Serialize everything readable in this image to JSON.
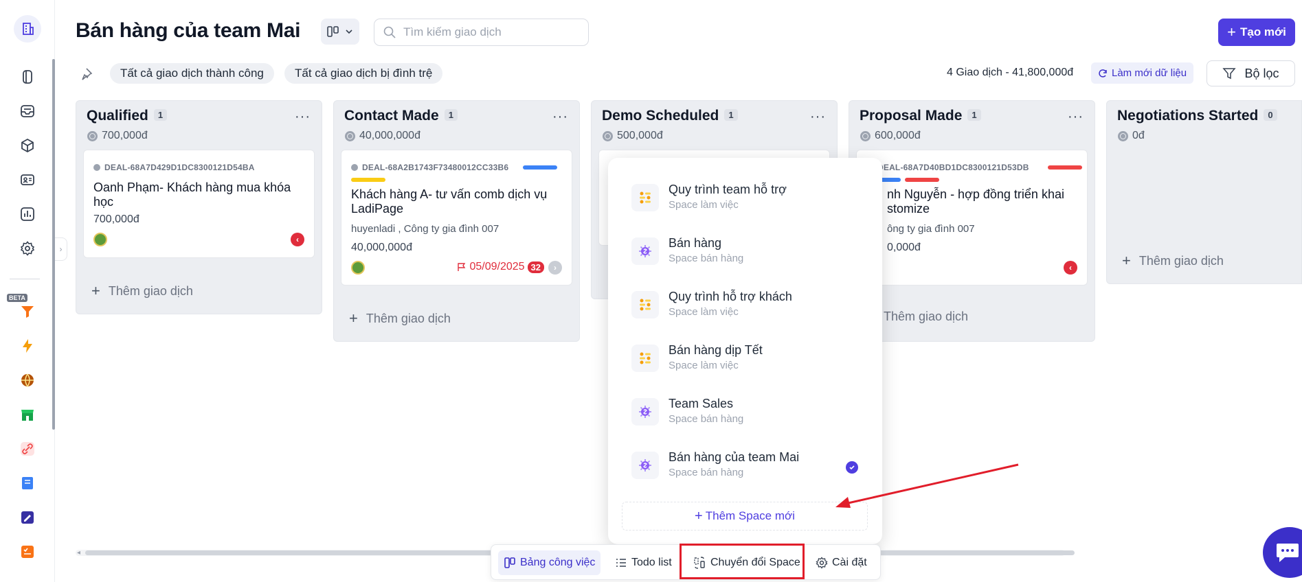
{
  "header": {
    "title": "Bán hàng của team Mai",
    "search_placeholder": "Tìm kiếm giao dịch",
    "create_label": "Tạo mới"
  },
  "filters": {
    "chip_success": "Tất cả giao dịch thành công",
    "chip_stalled": "Tất cả giao dịch bị đình trệ",
    "summary": "4 Giao dịch - 41,800,000đ",
    "refresh_label": "Làm mới dữ liệu",
    "filter_label": "Bộ lọc"
  },
  "sidebar": {
    "beta_label": "BETA",
    "icons": [
      "building-icon",
      "tablet-icon",
      "inbox-icon",
      "box-icon",
      "contact-card-icon",
      "chart-icon",
      "settings-icon",
      "funnel-icon",
      "lightning-icon",
      "globe-icon",
      "store-icon",
      "link-icon",
      "book-icon",
      "edit-note-icon",
      "checklist-icon"
    ]
  },
  "columns": [
    {
      "title": "Qualified",
      "count": "1",
      "amount": "700,000đ"
    },
    {
      "title": "Contact Made",
      "count": "1",
      "amount": "40,000,000đ"
    },
    {
      "title": "Demo Scheduled",
      "count": "1",
      "amount": "500,000đ"
    },
    {
      "title": "Proposal Made",
      "count": "1",
      "amount": "600,000đ"
    },
    {
      "title": "Negotiations Started",
      "count": "0",
      "amount": "0đ"
    }
  ],
  "cards": {
    "qualified": {
      "id": "DEAL-68A7D429D1DC8300121D54BA",
      "title": "Oanh Phạm- Khách hàng mua khóa học",
      "value": "700,000đ"
    },
    "contact": {
      "id": "DEAL-68A2B1743F73480012CC33B6",
      "title": "Khách hàng A- tư vấn comb dịch vụ LadiPage",
      "sub": "huyenladi , Công ty gia đình 007",
      "value": "40,000,000đ",
      "due": "05/09/2025",
      "due_count": "32"
    },
    "proposal": {
      "id": "DEAL-68A7D40BD1DC8300121D53DB",
      "title": "nh Nguyễn - hợp đồng triển khai stomize",
      "sub": "ông ty gia đình 007",
      "value": "0,000đ"
    }
  },
  "add_deal_label": "Thêm giao dịch",
  "popup": {
    "spaces": [
      {
        "name": "Quy trình team hỗ trợ",
        "type": "Space làm việc",
        "icon": "workflow-icon"
      },
      {
        "name": "Bán hàng",
        "type": "Space bán hàng",
        "icon": "sales-icon"
      },
      {
        "name": "Quy trình hỗ trợ khách",
        "type": "Space làm việc",
        "icon": "workflow-icon"
      },
      {
        "name": "Bán hàng dịp Tết",
        "type": "Space làm việc",
        "icon": "workflow-icon"
      },
      {
        "name": "Team Sales",
        "type": "Space bán hàng",
        "icon": "sales-icon"
      },
      {
        "name": "Bán hàng của team Mai",
        "type": "Space bán hàng",
        "icon": "sales-icon",
        "selected": true
      }
    ],
    "add_space_label": "Thêm Space mới"
  },
  "toolbar": {
    "board_label": "Bảng công việc",
    "todo_label": "Todo list",
    "switch_label": "Chuyển đổi Space",
    "settings_label": "Cài đặt"
  },
  "colors": {
    "accent": "#4f3ee0",
    "danger": "#e02d3c",
    "annotation": "#e11d2a"
  }
}
